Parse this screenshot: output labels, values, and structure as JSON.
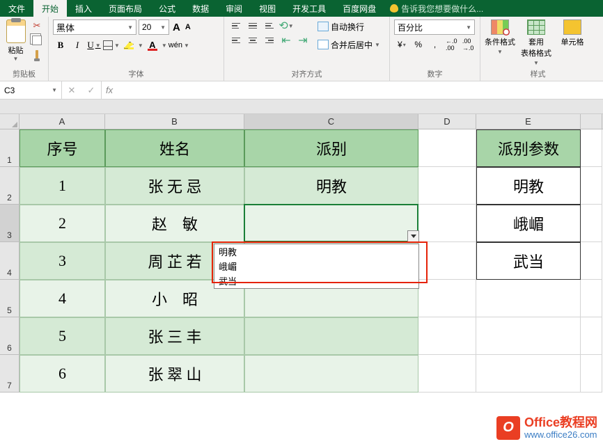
{
  "tabs": {
    "file": "文件",
    "home": "开始",
    "insert": "插入",
    "layout": "页面布局",
    "formulas": "公式",
    "data": "数据",
    "review": "审阅",
    "view": "视图",
    "dev": "开发工具",
    "baidu": "百度网盘",
    "tellme": "告诉我您想要做什么..."
  },
  "ribbon": {
    "clipboard": {
      "label": "剪贴板",
      "paste": "粘贴"
    },
    "font": {
      "label": "字体",
      "name": "黑体",
      "size": "20",
      "aa_big": "A",
      "aa_small": "A",
      "b": "B",
      "i": "I",
      "u": "U",
      "font_color_letter": "A"
    },
    "align": {
      "label": "对齐方式",
      "wrap": "自动换行",
      "merge": "合并后居中"
    },
    "number": {
      "label": "数字",
      "format": "百分比",
      "currency": "¥",
      "percent": "%",
      "comma": ",",
      "dec_inc": ".0←",
      "dec_dec": ".00→"
    },
    "styles": {
      "label": "样式",
      "cond": "条件格式",
      "table": "套用\n表格格式",
      "cell": "单元格"
    }
  },
  "formulabar": {
    "namebox": "C3",
    "fx": "fx"
  },
  "columns": {
    "A": "A",
    "B": "B",
    "C": "C",
    "D": "D",
    "E": "E"
  },
  "row_nums": [
    "1",
    "2",
    "3",
    "4",
    "5",
    "6",
    "7"
  ],
  "table": {
    "headers": {
      "seq": "序号",
      "name": "姓名",
      "faction": "派别"
    },
    "rows": [
      {
        "seq": "1",
        "name": "张 无 忌",
        "faction": "明教"
      },
      {
        "seq": "2",
        "name": "赵　敏",
        "faction": ""
      },
      {
        "seq": "3",
        "name": "周 芷 若",
        "faction": ""
      },
      {
        "seq": "4",
        "name": "小　昭",
        "faction": ""
      },
      {
        "seq": "5",
        "name": "张 三 丰",
        "faction": ""
      },
      {
        "seq": "6",
        "name": "张 翠 山",
        "faction": ""
      }
    ]
  },
  "param_col": {
    "header": "派别参数",
    "values": [
      "明教",
      "峨嵋",
      "武当"
    ]
  },
  "dropdown_items": [
    "明教",
    "峨嵋",
    "武当"
  ],
  "watermark": {
    "logo": "O",
    "title": "Office教程网",
    "url": "www.office26.com"
  }
}
